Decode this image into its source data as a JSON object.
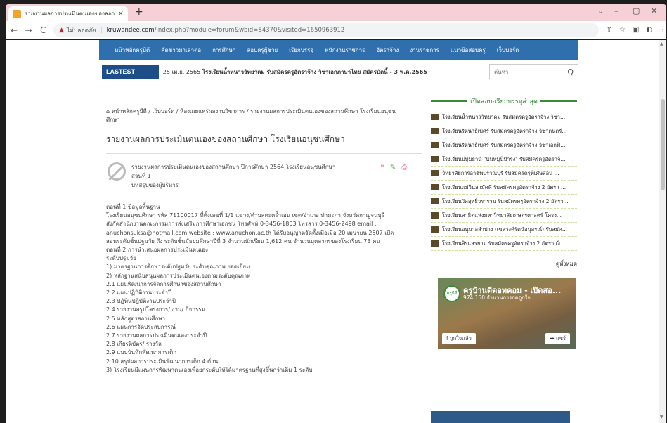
{
  "browser": {
    "tab_title": "รายงานผลการประเมินตนเองของสถาน",
    "tab_close": "×",
    "new_tab": "+",
    "window_controls": [
      "⌄",
      "–",
      "▢",
      "✕"
    ],
    "back": "←",
    "forward": "→",
    "reload": "C",
    "warning_icon": "▲",
    "insecure_label": "ไม่ปลอดภัย",
    "separator": "|",
    "url_domain": "kruwandee.com",
    "url_rest": "/index.php?module=forum&wbid=84370&visited=1650963912",
    "toolbar_icons": [
      "⇪",
      "☆",
      "▣",
      "◐",
      "⋮"
    ]
  },
  "menu": {
    "items": [
      "หน้าหลักครูบีดี",
      "คัดข่าวมาเล่าต่อ",
      "การศึกษา",
      "สอบครูผู้ช่วย",
      "เรียกบรรจุ",
      "พนักงานราชการ",
      "อัตราจ้าง",
      "งานราชการ",
      "แนวข้อสอบครู",
      "เว็บบอร์ด"
    ]
  },
  "ticker": {
    "badge": "LASTEST NEWS",
    "date": "25 เม.ย. 2565",
    "headline": "โรงเรียนน้ำหนาววิทยาคม รับสมัครครูอัตราจ้าง วิชาเอกภาษาไทย สมัครบัดนี้ - 3 พ.ค.2565"
  },
  "search": {
    "placeholder": "ค้นหา",
    "icon": "Q"
  },
  "breadcrumb": "⌂ หน้าหลักครูบีดี / เว็บบอร์ด / ห้องเผยแพร่ผลงานวิชาการ / รายงานผลการประเมินตนเองของสถานศึกษา โรงเรียนอนุชน ศึกษา",
  "breadcrumb_line1": "⌂ หน้าหลักครูบีดี / เว็บบอร์ด / ห้องเผยแพร่ผลงานวิชาการ / รายงานผลการประเมินตนเองของสถานศึกษา โรงเรียนอนุชน",
  "breadcrumb_line2": "ศึกษา",
  "page_title": "รายงานผลการประเมินตนเองของสถานศึกษา โรงเรียนอนุชนศึกษา",
  "post": {
    "head": [
      "รายงานผลการประเมินตนเองของสถานศึกษา ปีการศึกษา 2564 โรงเรียนอนุชนศึกษา",
      "ส่วนที่ 1",
      "บทสรุปของผู้บริหาร"
    ],
    "icons": {
      "quote": "❝",
      "edit": "✎",
      "print": "⎙"
    },
    "body": [
      "",
      "ตอนที่ 1   ข้อมูลพื้นฐาน",
      "   โรงเรียนอนุชนศึกษา รหัส 71100017 ที่ตั้งเลขที่ 1/1 แขวง/ตำบลตะคร้ำเอน เขต/อำเภอ ท่ามะกา จังหวัดกาญจนบุรี",
      "สังกัดสำนักงานคณะกรรมการส่งเสริมการศึกษาเอกชน โทรศัพท์ 0-3456-1803 โทรสาร 0-3456-2498 email :",
      "anuchonsuksa@hotmail.com website : www.anuchon.ac.th ได้รับอนุญาตจัดตั้งเมื่อเมื่อ 20 เมษายน 2507 เปิด",
      "สอนระดับชั้นปฐมวัย ถึง ระดับชั้นมัธยมศึกษาปีที่ 3 จำนวนนักเรียน 1,612 คน จำนวนบุคลากรของโรงเรียน 73 คน",
      "ตอนที่ 2   การนำเสนอผลการประเมินตนเอง",
      "ระดับปฐมวัย",
      "1)   มาตรฐานการศึกษาระดับปฐมวัย      ระดับคุณภาพ ยอดเยี่ยม",
      "2)   หลักฐานสนับสนุนผลการประเมินตนเองตามระดับคุณภาพ",
      "   2.1 แผนพัฒนาการจัดการศึกษาของสถานศึกษา",
      "   2.2 แผนปฏิบัติงานประจำปี",
      "2.3 ปฏิทินปฏิบัติงานประจำปี",
      "2.4 รายงานสรุปโครงการ/ งาน/ กิจกรรม",
      "2.5 หลักสูตรสถานศึกษา",
      "2.6 แผนการจัดประสบการณ์",
      "2.7 รายงานผลการประเมินตนเองประจำปี",
      "2.8 เกียรติบัตร/ รางวัล",
      "2.9 แบบบันทึกพัฒนาการเด็ก",
      "2.10 สรุปผลการประเมินพัฒนาการเด็ก 4 ด้าน",
      "3)   โรงเรียนมีแผนการพัฒนาตนเองเพื่อยกระดับให้ได้มาตรฐานที่สูงขึ้นกว่าเดิม 1 ระดับ"
    ]
  },
  "sidebar": {
    "title": "เปิดสอบ-เรียกบรรจุล่าสุด",
    "items": [
      "โรงเรียนน้ำหนาววิทยาคม รับสมัครครูอัตราจ้าง วิชา...",
      "โรงเรียนรัตนาธิเบศร์ รับสมัครครูอัตราจ้าง วิชาดนตรี...",
      "โรงเรียนรัตนาธิเบศร์ รับสมัครครูอัตราจ้าง วิชาเอกฟิ...",
      "โรงเรียนปทุมธานี \"นันทมุนิบำรุง\" รับสมัครครูอัตราจ้...",
      "วิทยาลัยการอาชีพปราณบุรี รับสมัครครูพิเศษสอน ...",
      "โรงเรียนแม่วินสามัคคี รับสมัครครูอัตราจ้าง 2 อัตรา ...",
      "โรงเรียนวัดสุทธิวราราม รับสมัครครูอัตราจ้าง 2 อัตรา...",
      "โรงเรียนสาธิตแห่งมหาวิทยาลัยเกษตรศาสตร์ โครง...",
      "โรงเรียนอนุบาลลำปาง (เขลางค์รัตน์อนุสรณ์) รับสมัค...",
      "โรงเรียนสิรแสรยาม รับสมัครครูอัตราจ้าง 2 อัตรา เงิ..."
    ],
    "see_all": "ดูทั้งหมด",
    "fb": {
      "logo_text": "ครูบีดี",
      "name": "ครูบ้านดีดอทคอม - เปิดสอ...",
      "likes": "974,150 จำนวนการกดถูกใจ",
      "like_button": "f ถูกใจแล้ว",
      "share_button": "➦ แชร์"
    }
  },
  "scrollbar": {
    "up": "▲",
    "down": "▼"
  },
  "colors": {
    "menu_bg": "#2f6fad",
    "badge_bg": "#1e4e88",
    "accent_green": "#2e7d32",
    "tab_strip": "#f5d0d6"
  }
}
